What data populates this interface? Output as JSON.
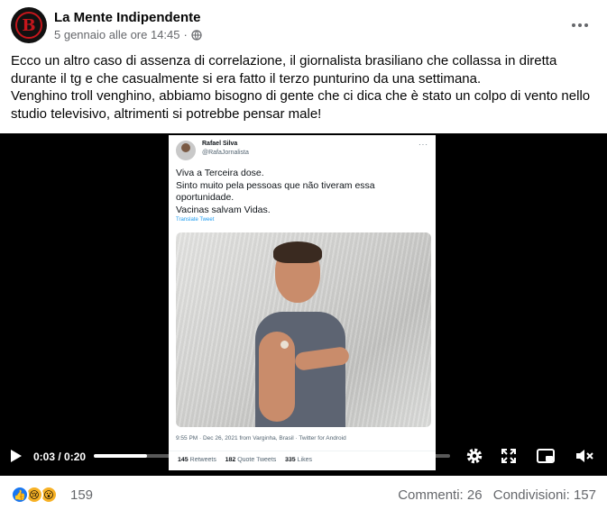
{
  "post": {
    "page_name": "La Mente Indipendente",
    "timestamp": "5 gennaio alle ore 14:45",
    "separator": "·",
    "text_lines": [
      "Ecco un altro caso di assenza di correlazione, il giornalista brasiliano che collassa in diretta",
      "durante il tg e che casualmente si era fatto il terzo punturino da una settimana.",
      "Venghino troll venghino, abbiamo bisogno di gente che ci dica che è stato un colpo di vento nello",
      "studio televisivo, altrimenti si potrebbe pensar male!"
    ]
  },
  "tweet": {
    "name": "Rafael Silva",
    "handle": "@RafaJornalista",
    "more": "···",
    "text_lines": [
      "Viva a Terceira dose.",
      "Sinto muito pela pessoas que não tiveram essa",
      "oportunidade.",
      "Vacinas salvam Vidas."
    ],
    "translate": "Translate Tweet",
    "footer": "9:55 PM · Dec 26, 2021 from Varginha, Brasil · Twitter for Android",
    "retweets": "145",
    "retweets_label": "Retweets",
    "quotes": "182",
    "quotes_label": "Quote Tweets",
    "likes": "335",
    "likes_label": "Likes"
  },
  "video": {
    "time": "0:03 / 0:20",
    "progress": 0.15
  },
  "engagement": {
    "reactions_count": "159",
    "comments": "Commenti: 26",
    "shares": "Condivisioni: 157"
  },
  "colors": {
    "brand": "#1877f2",
    "logo_red": "#c4161c",
    "muted_text": "#65676b"
  }
}
